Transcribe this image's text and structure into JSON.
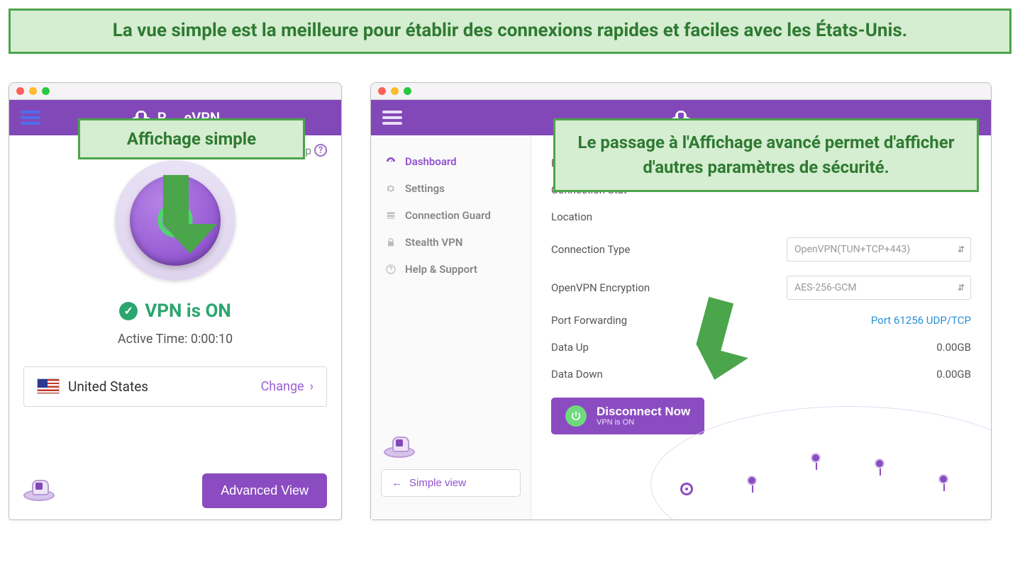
{
  "banner": "La vue simple est la meilleure pour établir des connexions rapides et faciles avec les États-Unis.",
  "callouts": {
    "simple_label": "Affichage simple",
    "advanced_label": "Le passage à l'Affichage avancé permet d'afficher d'autres paramètres de sécurité."
  },
  "brand": {
    "name_partial": "P     eVPN"
  },
  "simple": {
    "help": "Help",
    "status": "VPN is ON",
    "active_time_label": "Active Time:",
    "active_time_value": "0:00:10",
    "location": "United States",
    "change": "Change",
    "advanced_btn": "Advanced View"
  },
  "advanced": {
    "sidebar": {
      "dashboard": "Dashboard",
      "settings": "Settings",
      "connection_guard": "Connection Guard",
      "stealth_vpn": "Stealth VPN",
      "help_support": "Help & Support",
      "simple_view": "Simple view"
    },
    "fields": {
      "external_ip": "External IP",
      "connection_status_label_partial": "Connection Stat",
      "location": "Location",
      "connection_type": "Connection Type",
      "connection_type_value": "OpenVPN(TUN+TCP+443)",
      "encryption": "OpenVPN Encryption",
      "encryption_value": "AES-256-GCM",
      "port_forwarding": "Port Forwarding",
      "port_value": "Port 61256 UDP/TCP",
      "data_up": "Data Up",
      "data_up_value": "0.00GB",
      "data_down": "Data Down",
      "data_down_value": "0.00GB"
    },
    "disconnect": {
      "title": "Disconnect Now",
      "sub": "VPN is ON"
    }
  }
}
